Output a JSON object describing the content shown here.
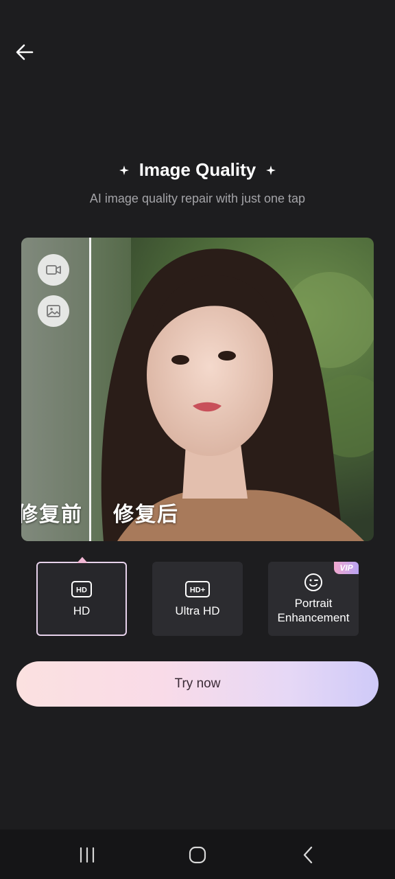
{
  "header": {
    "title": "Image Quality",
    "subtitle": "AI image quality repair with just one tap"
  },
  "preview": {
    "before_label": "修复前",
    "after_label": "修复后",
    "icons": [
      "video-icon",
      "image-icon"
    ]
  },
  "options": [
    {
      "label": "HD",
      "icon": "hd-icon",
      "selected": true
    },
    {
      "label": "Ultra HD",
      "icon": "hd-plus-icon",
      "selected": false
    },
    {
      "label": "Portrait Enhancement",
      "icon": "smile-face-icon",
      "selected": false,
      "badge": "VIP"
    }
  ],
  "cta": {
    "label": "Try now"
  },
  "colors": {
    "background": "#1d1d1f",
    "accent_border": "#e8d3ec",
    "button_gradient_start": "#fbe1e0",
    "button_gradient_end": "#cfcaf8"
  }
}
